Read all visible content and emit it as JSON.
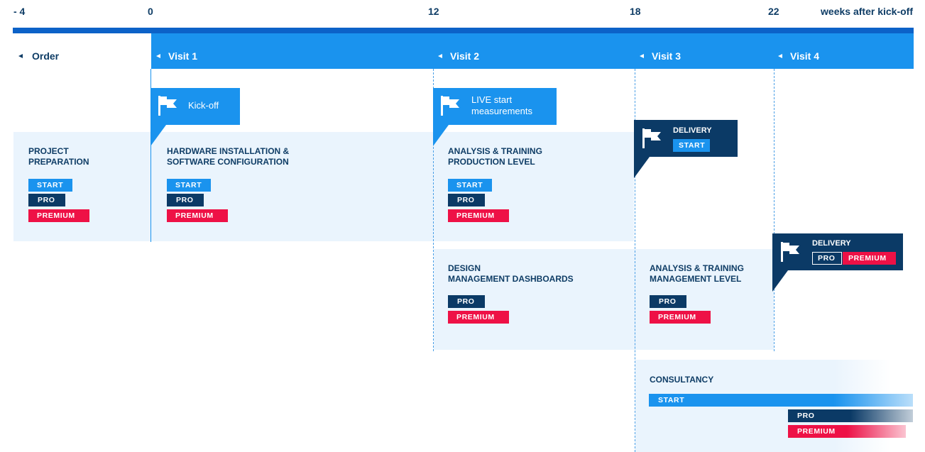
{
  "axis": {
    "ticks": [
      "- 4",
      "0",
      "12",
      "18",
      "22"
    ],
    "unit": "weeks after kick-off"
  },
  "phases": {
    "order": "Order",
    "visits": [
      "Visit 1",
      "Visit 2",
      "Visit 3",
      "Visit 4"
    ]
  },
  "milestones": {
    "kickoff": "Kick-off",
    "live_start": "LIVE start\nmeasurements",
    "delivery_start": {
      "label": "DELIVERY",
      "tag": "START"
    },
    "delivery_pro_premium": {
      "label": "DELIVERY",
      "tags": [
        "PRO",
        "PREMIUM"
      ]
    }
  },
  "packages": {
    "start": "START",
    "pro": "PRO",
    "premium": "PREMIUM"
  },
  "activities": [
    {
      "title_lines": [
        "PROJECT",
        "PREPARATION"
      ]
    },
    {
      "title_lines": [
        "HARDWARE INSTALLATION &",
        "SOFTWARE CONFIGURATION"
      ]
    },
    {
      "title_lines": [
        "ANALYSIS & TRAINING",
        "PRODUCTION LEVEL"
      ]
    },
    {
      "title_lines": [
        "DESIGN",
        "MANAGEMENT DASHBOARDS"
      ]
    },
    {
      "title_lines": [
        "ANALYSIS & TRAINING",
        "MANAGEMENT LEVEL"
      ]
    },
    {
      "title_lines": [
        "CONSULTANCY"
      ]
    }
  ],
  "colors": {
    "start_blue": "#1a93ee",
    "pro_navy": "#0b3a66",
    "premium_red": "#ee1146",
    "band_blue": "#1a93ee",
    "panel_bg": "#eaf4fd",
    "text_navy": "#0f3d66"
  },
  "icons": [
    "flag-icon",
    "arrow-left-icon"
  ]
}
